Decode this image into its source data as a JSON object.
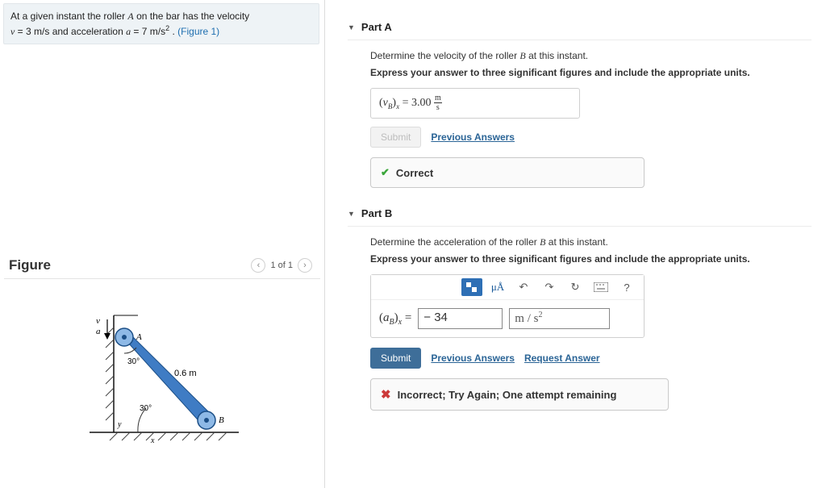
{
  "intro": {
    "line1_pre": "At a given instant the roller ",
    "rollerA": "A",
    "line1_post": " on the bar has the velocity",
    "v_sym": "v",
    "v_eq": " = 3 ",
    "v_unit": "m/s",
    "and_acc": " and acceleration ",
    "a_sym": "a",
    "a_eq": " = 7 ",
    "a_unit_base": "m/s",
    "a_unit_sup": "2",
    "period": " . ",
    "figlink": "(Figure 1)"
  },
  "figureSection": {
    "title": "Figure",
    "pager": "1 of 1",
    "labels": {
      "v": "v",
      "a": "a",
      "A": "A",
      "B": "B",
      "angle": "30°",
      "len": "0.6 m",
      "x": "x",
      "y": "y"
    }
  },
  "partA": {
    "title": "Part A",
    "prompt_pre": "Determine the velocity of the roller ",
    "B": "B",
    "prompt_post": " at this instant.",
    "instr": "Express your answer to three significant figures and include the appropriate units.",
    "ans_lhs_open": "(",
    "ans_lhs_var": "v",
    "ans_lhs_subB": "B",
    "ans_lhs_close": ")",
    "ans_lhs_subx": "x",
    "ans_eq": " =  ",
    "ans_val": "3.00 ",
    "ans_unit_top": "m",
    "ans_unit_bot": "s",
    "submit": "Submit",
    "prev": "Previous Answers",
    "feedback": "Correct"
  },
  "partB": {
    "title": "Part B",
    "prompt_pre": "Determine the acceleration of the roller ",
    "B": "B",
    "prompt_post": " at this instant.",
    "instr": "Express your answer to three significant figures and include the appropriate units.",
    "tb_units": "μÅ",
    "tb_help": "?",
    "lhs_open": "(",
    "lhs_var": "a",
    "lhs_subB": "B",
    "lhs_close": ")",
    "lhs_subx": "x",
    "lhs_eq": " = ",
    "value": "− 34",
    "unit_base": "m / s",
    "unit_sup": "2",
    "submit": "Submit",
    "prev": "Previous Answers",
    "req": "Request Answer",
    "feedback": "Incorrect; Try Again; One attempt remaining"
  }
}
